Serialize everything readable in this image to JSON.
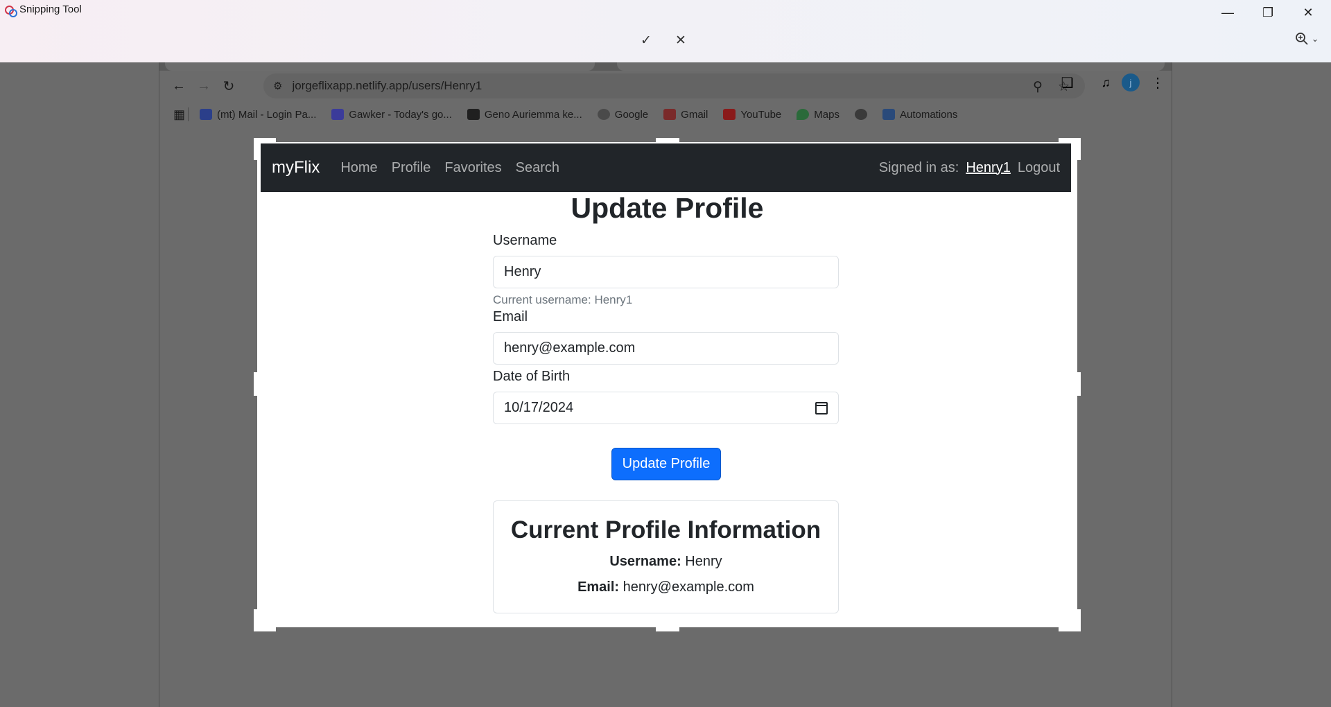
{
  "snipping_tool": {
    "app_title": "Snipping Tool",
    "icons": [
      "minimize-icon",
      "restore-icon",
      "close-icon",
      "check-icon",
      "discard-icon",
      "zoom-icon",
      "chevron-down-icon"
    ]
  },
  "browser": {
    "url": "jorgeflixapp.netlify.app/users/Henry1",
    "avatar_letter": "j",
    "bookmarks": [
      {
        "label": "(mt) Mail - Login Pa...",
        "color": "#2b3f8a"
      },
      {
        "label": "Gawker - Today's go...",
        "color": "#3b3b9a"
      },
      {
        "label": "Geno Auriemma ke...",
        "color": "#202020"
      },
      {
        "label": "Google",
        "color": "#4a4a4a"
      },
      {
        "label": "Gmail",
        "color": "#7a2a2a"
      },
      {
        "label": "YouTube",
        "color": "#8a1a1a"
      },
      {
        "label": "Maps",
        "color": "#2a6a3a"
      },
      {
        "label": "",
        "color": "#3a3a3a"
      },
      {
        "label": "Automations",
        "color": "#2a4a7a"
      }
    ]
  },
  "app": {
    "brand": "myFlix",
    "nav": {
      "home": "Home",
      "profile": "Profile",
      "favorites": "Favorites",
      "search": "Search"
    },
    "signed_in_label": "Signed in as:",
    "signed_in_user": "Henry1",
    "logout": "Logout"
  },
  "form": {
    "title": "Update Profile",
    "username_label": "Username",
    "username_value": "Henry",
    "username_help": "Current username: Henry1",
    "email_label": "Email",
    "email_value": "henry@example.com",
    "dob_label": "Date of Birth",
    "dob_value": "10/17/2024",
    "submit": "Update Profile"
  },
  "profile_card": {
    "title": "Current Profile Information",
    "username_key": "Username:",
    "username_value": "Henry",
    "email_key": "Email:",
    "email_value": "henry@example.com"
  },
  "colors": {
    "navbar": "#212529",
    "primary": "#0d6efd"
  }
}
